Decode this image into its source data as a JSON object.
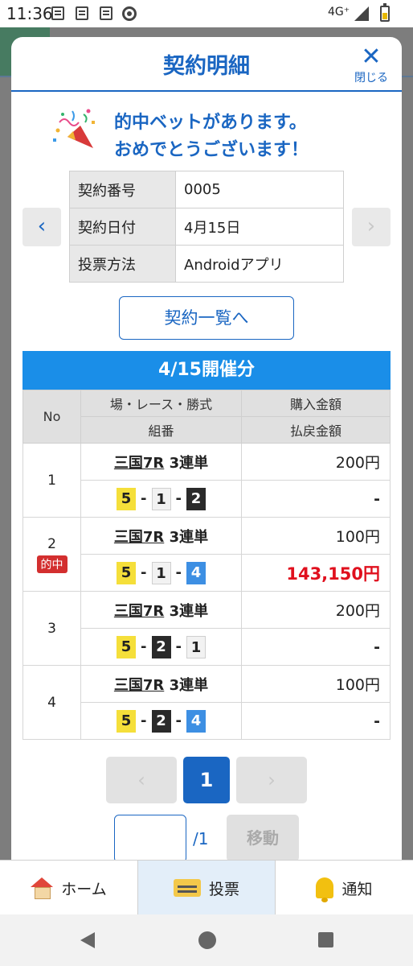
{
  "status_bar": {
    "time": "11:36",
    "network": "4G⁺"
  },
  "modal": {
    "title": "契約明細",
    "close_label": "閉じる",
    "win_message_line1": "的中ベットがあります。",
    "win_message_line2": "おめでとうございます！"
  },
  "contract": {
    "rows": [
      {
        "key": "契約番号",
        "value": "0005"
      },
      {
        "key": "契約日付",
        "value": "4月15日"
      },
      {
        "key": "投票方法",
        "value": "Androidアプリ"
      }
    ],
    "list_button": "契約一覧へ"
  },
  "bets": {
    "day_title": "4/15開催分",
    "headers": {
      "no": "No",
      "race": "場・レース・勝式",
      "combination": "組番",
      "purchase": "購入金額",
      "payout": "払戻金額"
    },
    "hit_badge": "的中",
    "rows": [
      {
        "no": "1",
        "venue": "三国7R",
        "type": "3連単",
        "c1": "5",
        "c2": "1",
        "c3": "2",
        "sep": "-",
        "amount": "200円",
        "payout": "-"
      },
      {
        "no": "2",
        "venue": "三国7R",
        "type": "3連単",
        "c1": "5",
        "c2": "1",
        "c3": "4",
        "sep": "-",
        "amount": "100円",
        "payout": "143,150円"
      },
      {
        "no": "3",
        "venue": "三国7R",
        "type": "3連単",
        "c1": "5",
        "c2": "2",
        "c3": "1",
        "sep": "-",
        "amount": "200円",
        "payout": "-"
      },
      {
        "no": "4",
        "venue": "三国7R",
        "type": "3連単",
        "c1": "5",
        "c2": "2",
        "c3": "4",
        "sep": "-",
        "amount": "100円",
        "payout": "-"
      }
    ]
  },
  "pagination": {
    "prev": "‹",
    "current": "1",
    "next": "›",
    "total": "/1",
    "go_label": "移動",
    "input_value": ""
  },
  "bottom_nav": {
    "home": "ホーム",
    "vote": "投票",
    "notice": "通知"
  },
  "colors": {
    "primary": "#1a66c2",
    "day_bar": "#1a8ee8",
    "win_red": "#e0101e"
  }
}
